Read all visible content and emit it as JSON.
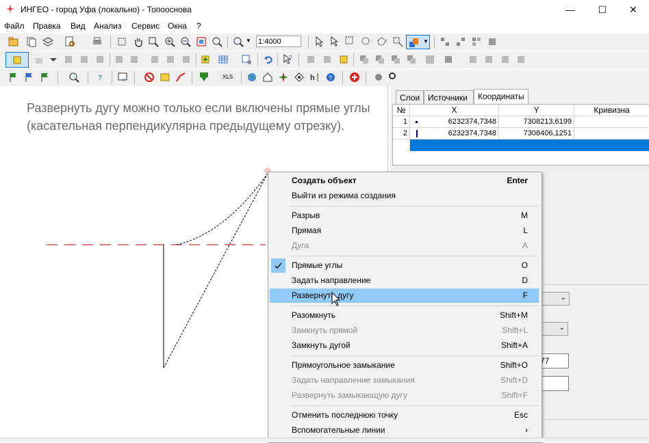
{
  "window": {
    "title": "ИНГЕО - город Уфа (локально) - Топооснова",
    "minimize": "—",
    "maximize": "☐",
    "close": "✕"
  },
  "menu": [
    "Файл",
    "Правка",
    "Вид",
    "Анализ",
    "Сервис",
    "Окна",
    "?"
  ],
  "toolbar": {
    "scale_value": "1:4000",
    "xls_label": "XLS"
  },
  "canvas": {
    "hint": "Развернуть дугу можно только если включены прямые углы (касательная перпендикулярна предыдущему отрезку)."
  },
  "panel": {
    "tabs": [
      "Слои",
      "Источники",
      "Координаты"
    ],
    "active_tab": "Координаты",
    "columns": [
      "№",
      "X",
      "Y",
      "Кривизна"
    ],
    "rows": [
      {
        "n": "1",
        "x": "6232374,7348",
        "y": "7308213,6199",
        "curv": ""
      },
      {
        "n": "2",
        "x": "6232374,7348",
        "y": "7308406,1251",
        "curv": ""
      }
    ],
    "field_partial": "77"
  },
  "context_menu": {
    "items": [
      {
        "label": "Создать объект",
        "key": "Enter"
      },
      {
        "label": "Выйти из режима создания",
        "key": ""
      },
      {
        "label": "Разрыв",
        "key": "M"
      },
      {
        "label": "Прямая",
        "key": "L"
      },
      {
        "label": "Дуга",
        "key": "A"
      },
      {
        "label": "Прямые углы",
        "key": "O"
      },
      {
        "label": "Задать направление",
        "key": "D"
      },
      {
        "label": "Развернуть дугу",
        "key": "F"
      },
      {
        "label": "Разомкнуть",
        "key": "Shift+M"
      },
      {
        "label": "Замкнуть прямой",
        "key": "Shift+L"
      },
      {
        "label": "Замкнуть дугой",
        "key": "Shift+A"
      },
      {
        "label": "Прямоугольное замыкание",
        "key": "Shift+O"
      },
      {
        "label": "Задать направление замыкания",
        "key": "Shift+D"
      },
      {
        "label": "Развернуть замыкающую дугу",
        "key": "Shift+F"
      },
      {
        "label": "Отменить последнюю точку",
        "key": "Esc"
      },
      {
        "label": "Вспомогательные линии",
        "key": "›"
      }
    ]
  },
  "colors": {
    "selection": "#0078d7",
    "menu_highlight": "#91c9f7",
    "guide_line": "#c0392b"
  }
}
